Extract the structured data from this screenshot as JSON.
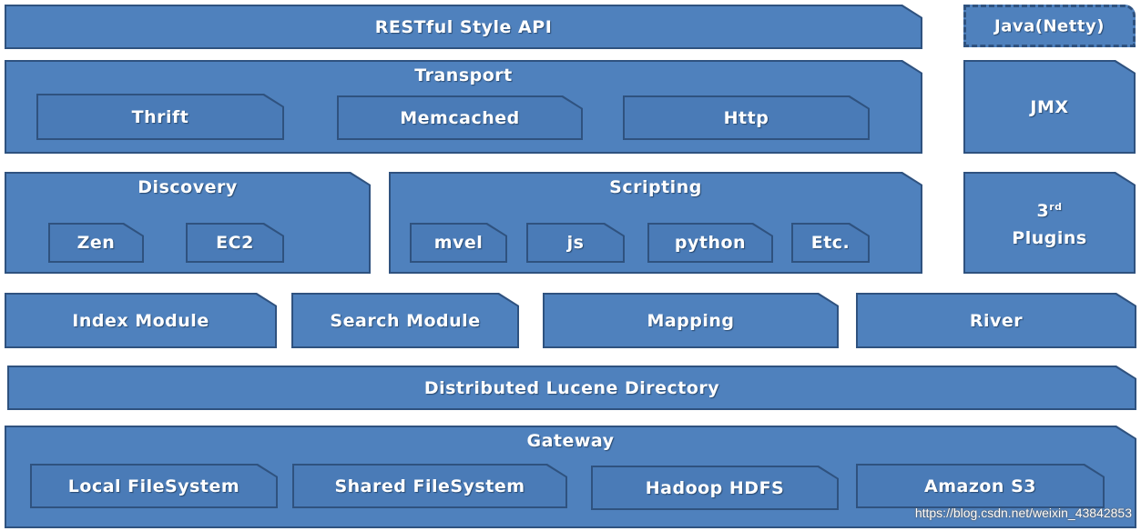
{
  "fill_color": "#4f81bd",
  "border_color": "#2f527f",
  "api": {
    "label": "RESTful Style API"
  },
  "java": {
    "label": "Java(Netty)"
  },
  "transport": {
    "label": "Transport",
    "items": [
      "Thrift",
      "Memcached",
      "Http"
    ]
  },
  "jmx": {
    "label": "JMX"
  },
  "discovery": {
    "label": "Discovery",
    "items": [
      "Zen",
      "EC2"
    ]
  },
  "scripting": {
    "label": "Scripting",
    "items": [
      "mvel",
      "js",
      "python",
      "Etc."
    ]
  },
  "plugins": {
    "num": "3",
    "sup": "rd",
    "label": "Plugins"
  },
  "modules": [
    "Index Module",
    "Search Module",
    "Mapping",
    "River"
  ],
  "lucene": {
    "label": "Distributed Lucene Directory"
  },
  "gateway": {
    "label": "Gateway",
    "items": [
      "Local FileSystem",
      "Shared FileSystem",
      "Hadoop HDFS",
      "Amazon S3"
    ]
  },
  "watermark": "https://blog.csdn.net/weixin_43842853"
}
